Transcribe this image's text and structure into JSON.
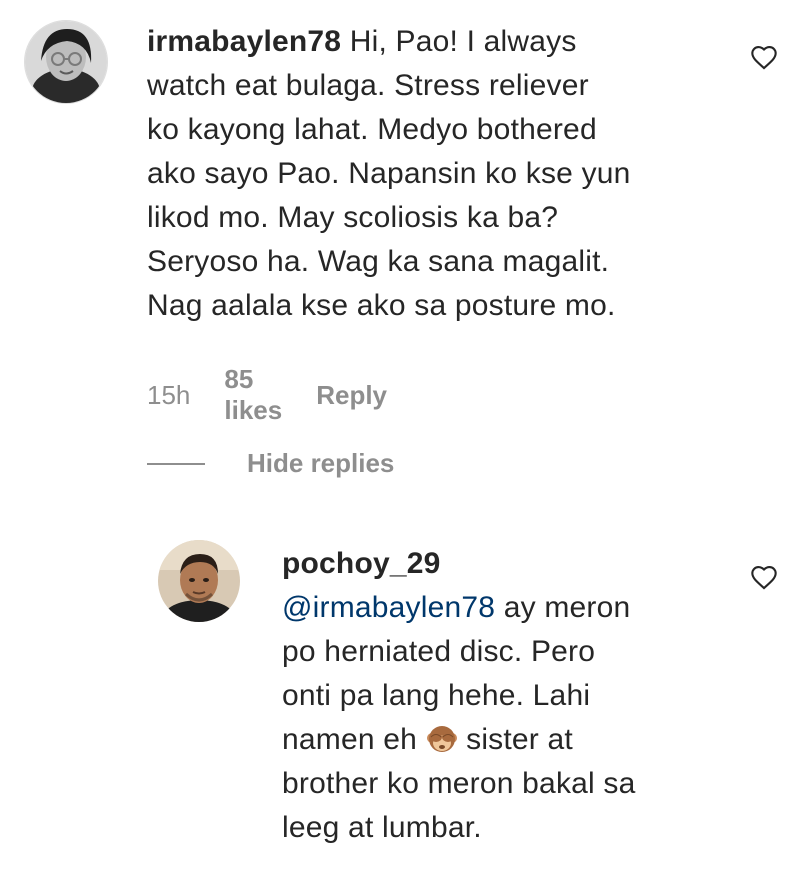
{
  "comment": {
    "username": "irmabaylen78",
    "text_lines": [
      "Hi, Pao! I always",
      "watch eat bulaga. Stress reliever",
      "ko kayong lahat. Medyo bothered",
      "ako sayo Pao. Napansin ko kse yun",
      "likod mo. May scoliosis ka ba?",
      "Seryoso ha. Wag ka sana magalit.",
      "Nag aalala kse ako sa posture mo."
    ],
    "time": "15h",
    "likes": "85 likes",
    "reply_label": "Reply",
    "avatar_icon": "profile-photo",
    "like_icon": "heart-outline-icon"
  },
  "replies_toggle": {
    "label": "Hide replies"
  },
  "reply": {
    "username": "pochoy_29",
    "mention": "@irmabaylen78",
    "line1_rest": " ay meron",
    "text_lines": [
      "po herniated disc. Pero",
      "onti pa lang hehe. Lahi"
    ],
    "line4_before_emoji": "namen eh ",
    "emoji": "see-no-evil-monkey",
    "line4_after_emoji": " sister at",
    "text_lines_end": [
      "brother ko meron bakal sa",
      "leeg at lumbar."
    ],
    "avatar_icon": "profile-photo",
    "like_icon": "heart-outline-icon"
  },
  "colors": {
    "text": "#262626",
    "meta": "#8e8e8e",
    "mention": "#00376b"
  }
}
